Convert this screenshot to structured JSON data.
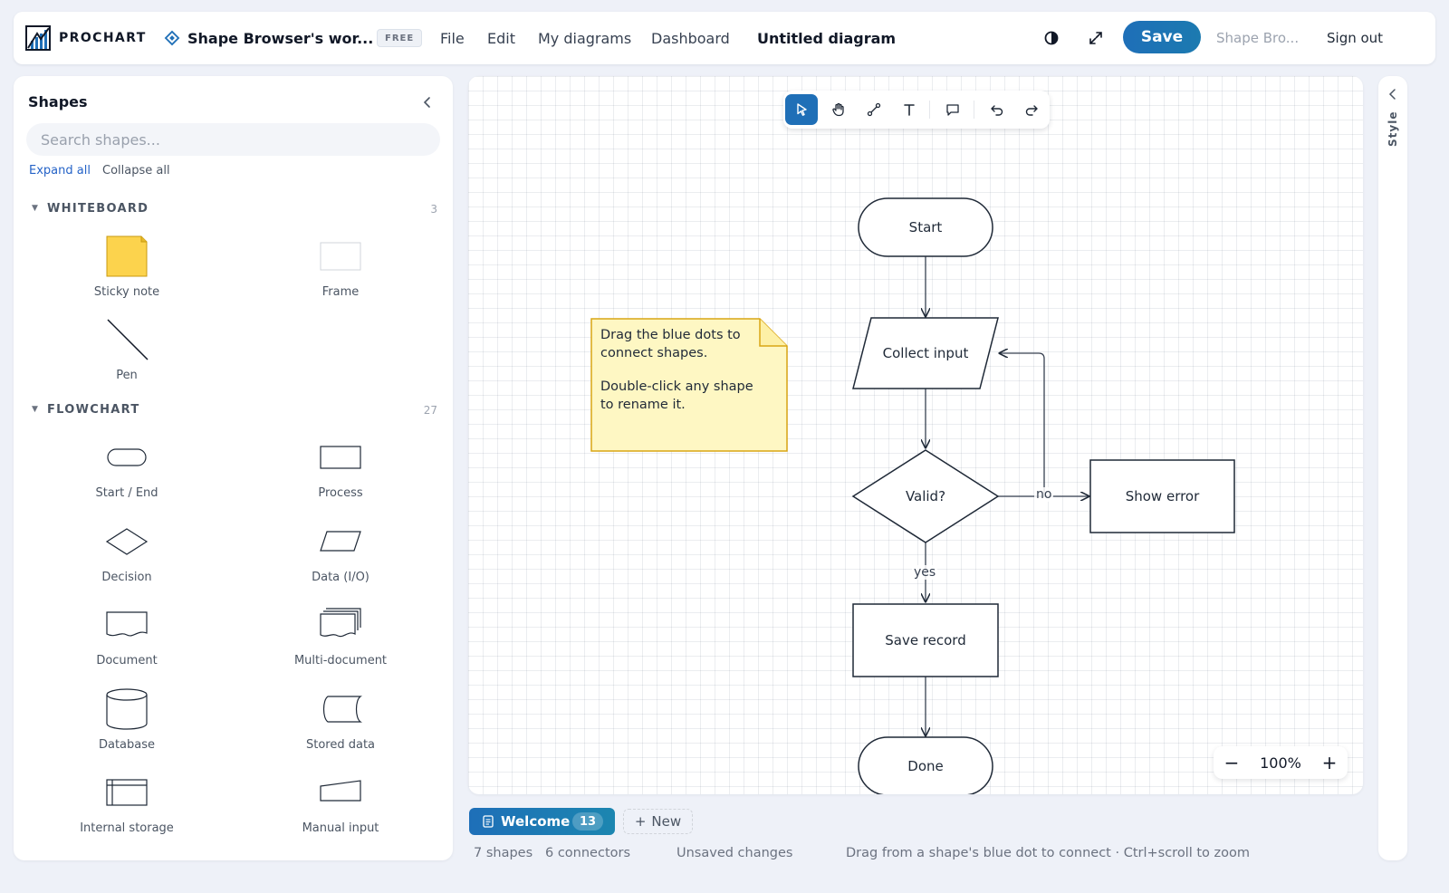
{
  "header": {
    "logo_text": "PROCHART",
    "workspace_name": "Shape Browser's wor...",
    "plan_badge": "FREE",
    "menu": [
      "File",
      "Edit",
      "My diagrams",
      "Dashboard"
    ],
    "document_title": "Untitled diagram",
    "save_label": "Save",
    "user_name": "Shape Bro...",
    "sign_out_label": "Sign out"
  },
  "shapes_panel": {
    "title": "Shapes",
    "search_placeholder": "Search shapes...",
    "expand_all": "Expand all",
    "collapse_all": "Collapse all",
    "sections": [
      {
        "label": "WHITEBOARD",
        "count": "3",
        "items": [
          {
            "label": "Sticky note",
            "icon": "sticky-note-icon"
          },
          {
            "label": "Frame",
            "icon": "frame-icon"
          },
          {
            "label": "Pen",
            "icon": "pen-line-icon"
          }
        ]
      },
      {
        "label": "FLOWCHART",
        "count": "27",
        "items": [
          {
            "label": "Start / End",
            "icon": "terminator-icon"
          },
          {
            "label": "Process",
            "icon": "process-icon"
          },
          {
            "label": "Decision",
            "icon": "decision-icon"
          },
          {
            "label": "Data (I/O)",
            "icon": "data-io-icon"
          },
          {
            "label": "Document",
            "icon": "document-icon"
          },
          {
            "label": "Multi-document",
            "icon": "multi-document-icon"
          },
          {
            "label": "Database",
            "icon": "database-icon"
          },
          {
            "label": "Stored data",
            "icon": "stored-data-icon"
          },
          {
            "label": "Internal storage",
            "icon": "internal-storage-icon"
          },
          {
            "label": "Manual input",
            "icon": "manual-input-icon"
          }
        ]
      }
    ]
  },
  "toolbar": {
    "tools": [
      "select-tool",
      "pan-tool",
      "connector-tool",
      "text-tool",
      "comment-tool",
      "undo",
      "redo"
    ],
    "active_tool": "select-tool"
  },
  "diagram": {
    "sticky_note": {
      "paragraphs": [
        "Drag the blue dots to connect shapes.",
        "Double-click any shape to rename it."
      ],
      "fill": "#fef7c3",
      "stroke": "#d9a514"
    },
    "nodes": {
      "start": "Start",
      "collect_input": "Collect input",
      "valid": "Valid?",
      "show_error": "Show error",
      "save_record": "Save record",
      "done": "Done"
    },
    "edge_labels": {
      "no": "no",
      "yes": "yes"
    }
  },
  "zoom": {
    "level": "100%",
    "minus": "−",
    "plus": "+"
  },
  "right_rail": {
    "label": "Style"
  },
  "pages": {
    "active_tab": {
      "name": "Welcome",
      "count": "13"
    },
    "new_tab": "New"
  },
  "status_bar": {
    "shapes": "7 shapes",
    "connectors": "6 connectors",
    "save_state": "Unsaved changes",
    "hint": "Drag from a shape's blue dot to connect · Ctrl+scroll to zoom"
  },
  "colors": {
    "accent": "#1f6fb7",
    "shape_stroke": "#1f2937",
    "canvas_bg": "#ffffff",
    "app_bg": "#eef1f8"
  }
}
